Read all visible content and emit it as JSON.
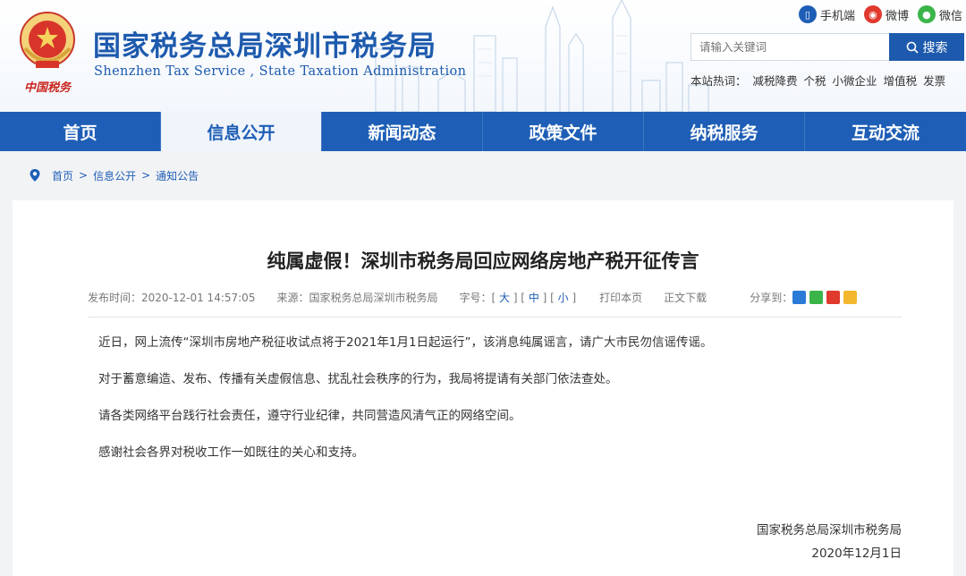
{
  "header": {
    "title": "国家税务总局深圳市税务局",
    "subtitle": "Shenzhen Tax Service , State Taxation Administration",
    "emblem_caption": "中国税务",
    "links": [
      {
        "label": "手机端",
        "icon": "mobile-icon",
        "color": "#1e5eb6"
      },
      {
        "label": "微博",
        "icon": "weibo-icon",
        "color": "#e0392e"
      },
      {
        "label": "微信",
        "icon": "wechat-icon",
        "color": "#3bb54a"
      }
    ],
    "search": {
      "placeholder": "请输入关键词",
      "button": "搜索"
    },
    "hotwords_label": "本站热词：",
    "hotwords": [
      "减税降费",
      "个税",
      "小微企业",
      "增值税",
      "发票"
    ]
  },
  "nav": {
    "items": [
      "首页",
      "信息公开",
      "新闻动态",
      "政策文件",
      "纳税服务",
      "互动交流"
    ],
    "active_index": 1
  },
  "breadcrumb": {
    "items": [
      "首页",
      "信息公开",
      "通知公告"
    ],
    "separator": ">"
  },
  "article": {
    "title": "纯属虚假！深圳市税务局回应网络房地产税开征传言",
    "publish_time": "发布时间：2020-12-01 14:57:05",
    "source": "来源：国家税务总局深圳市税务局",
    "font_size_label": "字号：",
    "font_sizes": [
      "大",
      "中",
      "小"
    ],
    "print": "打印本页",
    "download": "正文下载",
    "share_label": "分享到：",
    "paragraphs": [
      "近日，网上流传“深圳市房地产税征收试点将于2021年1月1日起运行”，该消息纯属谣言，请广大市民勿信谣传谣。",
      "对于蓄意编造、发布、传播有关虚假信息、扰乱社会秩序的行为，我局将提请有关部门依法查处。",
      "请各类网络平台践行社会责任，遵守行业纪律，共同营造风清气正的网络空间。",
      "感谢社会各界对税收工作一如既往的关心和支持。"
    ],
    "signature": "国家税务总局深圳市税务局",
    "date": "2020年12月1日"
  },
  "colors": {
    "brand": "#1e5eb6",
    "nav_active_bg": "#f0f4fb",
    "page_bg": "#f2f3f5"
  }
}
